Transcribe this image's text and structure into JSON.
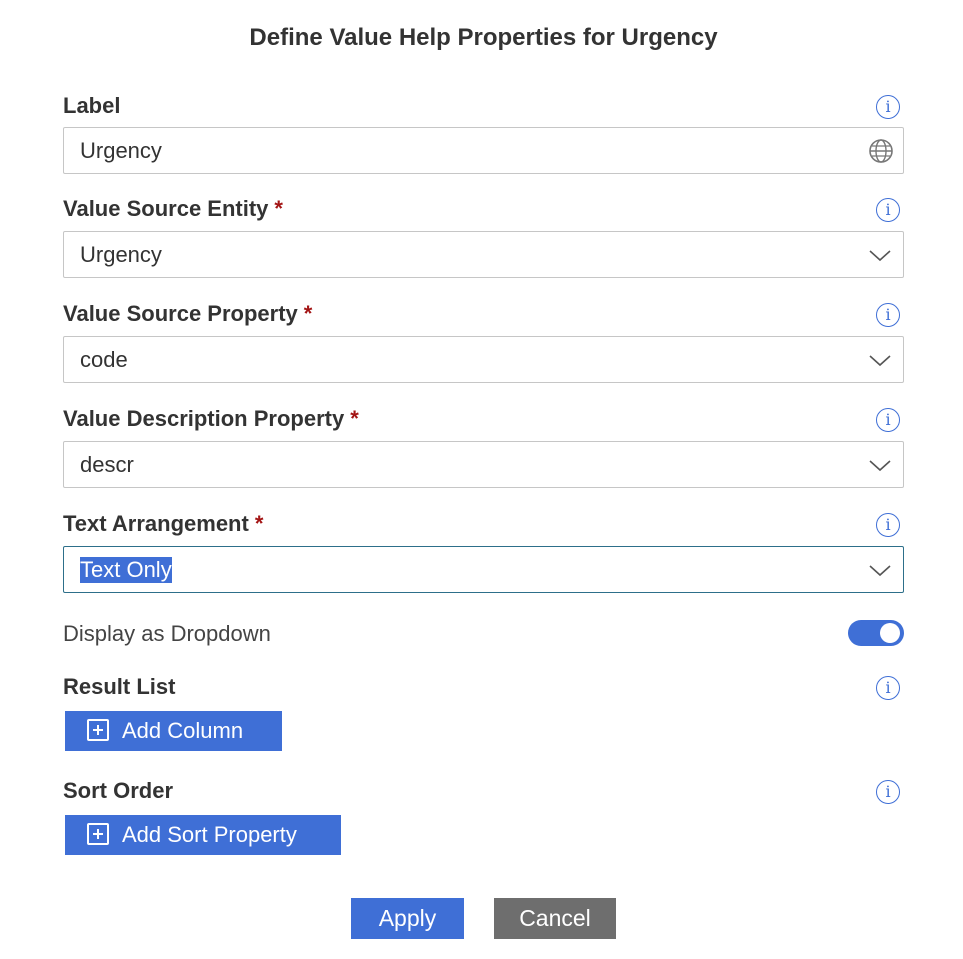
{
  "dialog": {
    "title": "Define Value Help Properties for Urgency"
  },
  "fields": {
    "label": {
      "label": "Label",
      "value": "Urgency"
    },
    "value_source_entity": {
      "label": "Value Source Entity",
      "required_mark": "*",
      "value": "Urgency"
    },
    "value_source_property": {
      "label": "Value Source Property",
      "required_mark": "*",
      "value": "code"
    },
    "value_description_property": {
      "label": "Value Description Property",
      "required_mark": "*",
      "value": "descr"
    },
    "text_arrangement": {
      "label": "Text Arrangement",
      "required_mark": "*",
      "value": "Text Only"
    }
  },
  "display_as_dropdown": {
    "label": "Display as Dropdown",
    "enabled": true
  },
  "result_list": {
    "label": "Result List",
    "add_button": "Add Column"
  },
  "sort_order": {
    "label": "Sort Order",
    "add_button": "Add Sort Property"
  },
  "footer": {
    "apply": "Apply",
    "cancel": "Cancel"
  },
  "icons": {
    "info": "i"
  },
  "colors": {
    "accent": "#3f6fd6",
    "required": "#a31515",
    "cancel": "#6e6e6e"
  }
}
